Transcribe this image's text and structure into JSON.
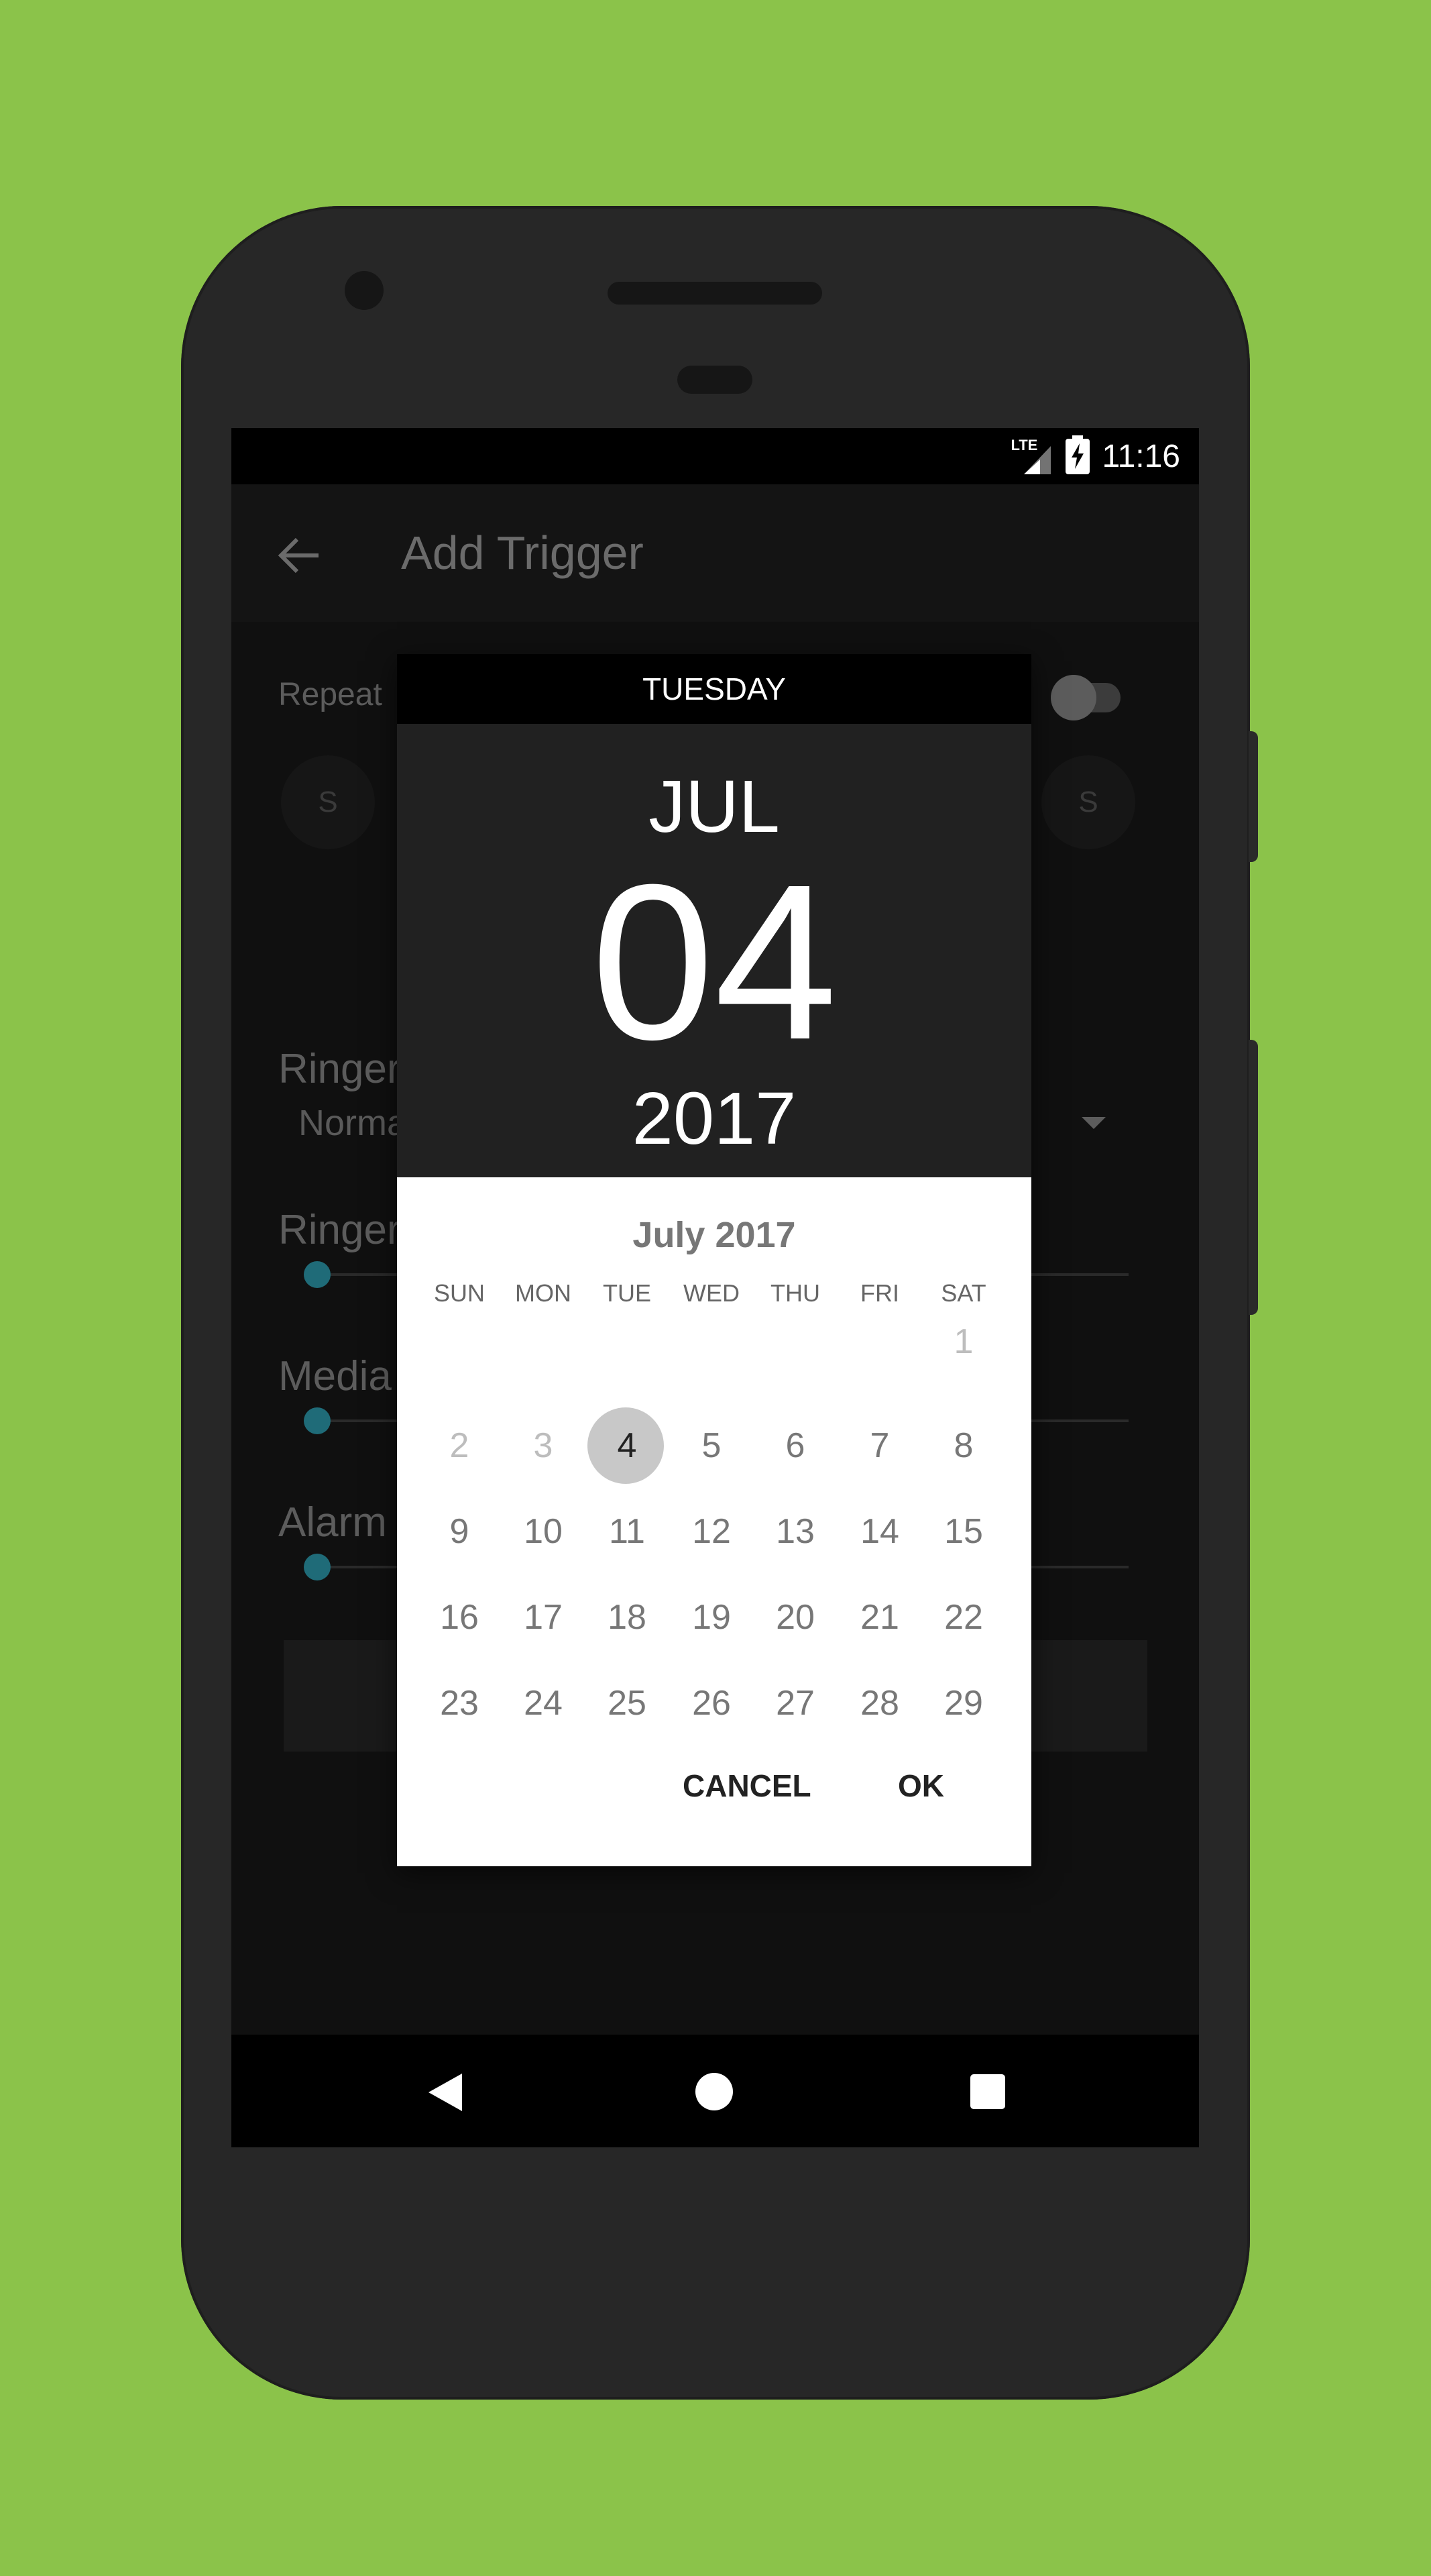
{
  "status_bar": {
    "network": "LTE",
    "time": "11:16"
  },
  "app_bar": {
    "title": "Add Trigger",
    "back_icon": "arrow-left-icon"
  },
  "background_form": {
    "repeat_label": "Repeat",
    "days": [
      "S",
      "S"
    ],
    "ringer_mode_label": "Ringer",
    "ringer_mode_value": "Norma",
    "volumes": [
      {
        "label": "Ringer",
        "level": 0
      },
      {
        "label": "Media",
        "level": 0
      },
      {
        "label": "Alarm",
        "level": 0
      }
    ]
  },
  "date_picker": {
    "day_name": "TUESDAY",
    "header_month": "JUL",
    "header_day": "04",
    "header_year": "2017",
    "calendar_title": "July 2017",
    "weekdays": [
      "SUN",
      "MON",
      "TUE",
      "WED",
      "THU",
      "FRI",
      "SAT"
    ],
    "weeks": [
      [
        "",
        "",
        "",
        "",
        "",
        "",
        "1"
      ],
      [
        "2",
        "3",
        "4",
        "5",
        "6",
        "7",
        "8"
      ],
      [
        "9",
        "10",
        "11",
        "12",
        "13",
        "14",
        "15"
      ],
      [
        "16",
        "17",
        "18",
        "19",
        "20",
        "21",
        "22"
      ],
      [
        "23",
        "24",
        "25",
        "26",
        "27",
        "28",
        "29"
      ]
    ],
    "selected_day": "4",
    "disabled_days": [
      "1",
      "2",
      "3"
    ],
    "cancel_label": "CANCEL",
    "ok_label": "OK"
  },
  "nav_bar": {
    "back_icon": "nav-back-icon",
    "home_icon": "nav-home-icon",
    "recent_icon": "nav-recent-icon"
  },
  "colors": {
    "background": "#8bc34a",
    "slider_accent": "#1f6b78",
    "dialog_header": "#212121"
  }
}
